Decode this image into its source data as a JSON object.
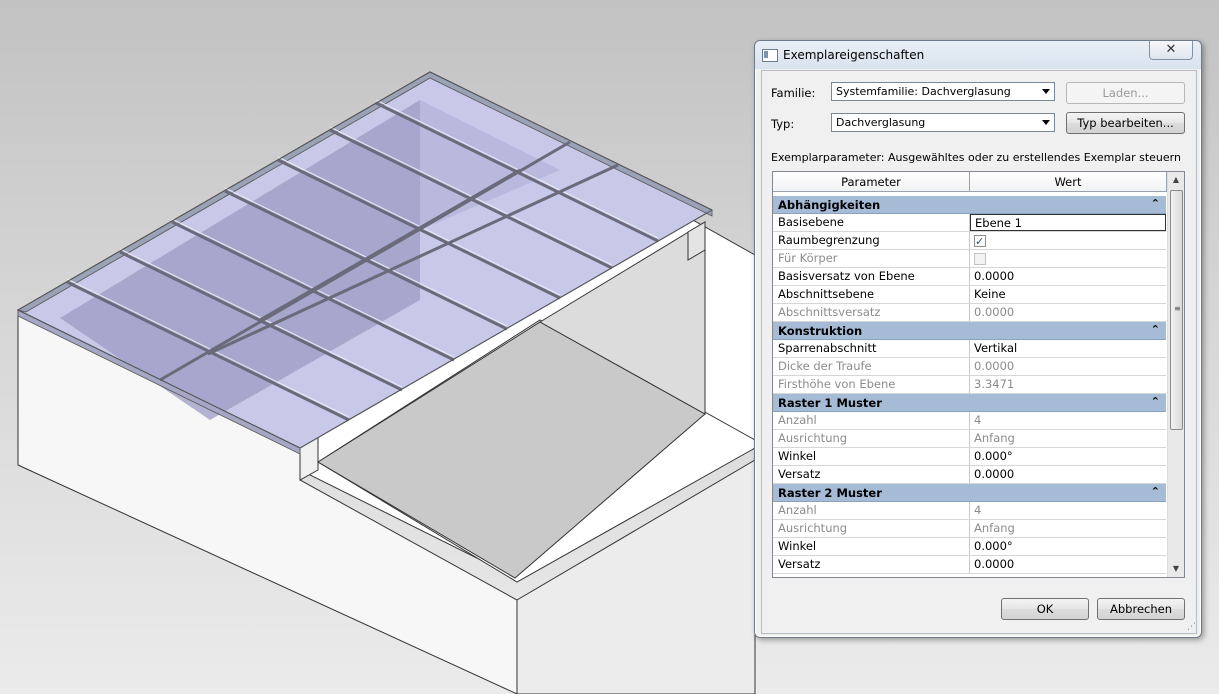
{
  "dialog": {
    "title": "Exemplareigenschaften",
    "close_glyph": "✕",
    "family_label": "Familie:",
    "family_value": "Systemfamilie: Dachverglasung",
    "type_label": "Typ:",
    "type_value": "Dachverglasung",
    "load_button": "Laden...",
    "edit_type_button": "Typ bearbeiten...",
    "instance_param_label": "Exemplarparameter: Ausgewähltes oder zu erstellendes Exemplar steuern",
    "ok_button": "OK",
    "cancel_button": "Abbrechen"
  },
  "grid": {
    "col_param": "Parameter",
    "col_value": "Wert",
    "groups": {
      "g1": "Abhängigkeiten",
      "g2": "Konstruktion",
      "g3": "Raster 1 Muster",
      "g4": "Raster 2 Muster",
      "collapse_glyph": "⌃"
    },
    "r1": {
      "p": "Basisebene",
      "v": "Ebene 1"
    },
    "r2": {
      "p": "Raumbegrenzung",
      "checked": true
    },
    "r3": {
      "p": "Für Körper",
      "checked": false
    },
    "r4": {
      "p": "Basisversatz von Ebene",
      "v": "0.0000"
    },
    "r5": {
      "p": "Abschnittsebene",
      "v": "Keine"
    },
    "r6": {
      "p": "Abschnittsversatz",
      "v": "0.0000"
    },
    "r7": {
      "p": "Sparrenabschnitt",
      "v": "Vertikal"
    },
    "r8": {
      "p": "Dicke der Traufe",
      "v": "0.0000"
    },
    "r9": {
      "p": "Firsthöhe von Ebene",
      "v": "3.3471"
    },
    "r10": {
      "p": "Anzahl",
      "v": "4"
    },
    "r11": {
      "p": "Ausrichtung",
      "v": "Anfang"
    },
    "r12": {
      "p": "Winkel",
      "v": "0.000°"
    },
    "r13": {
      "p": "Versatz",
      "v": "0.0000"
    },
    "r14": {
      "p": "Anzahl",
      "v": "4"
    },
    "r15": {
      "p": "Ausrichtung",
      "v": "Anfang"
    },
    "r16": {
      "p": "Winkel",
      "v": "0.000°"
    },
    "r17": {
      "p": "Versatz",
      "v": "0.0000"
    }
  },
  "colors": {
    "group_header": "#a5bbd6",
    "glass": "#b9b9e0",
    "viewport_bg": "#d0d0d0"
  }
}
